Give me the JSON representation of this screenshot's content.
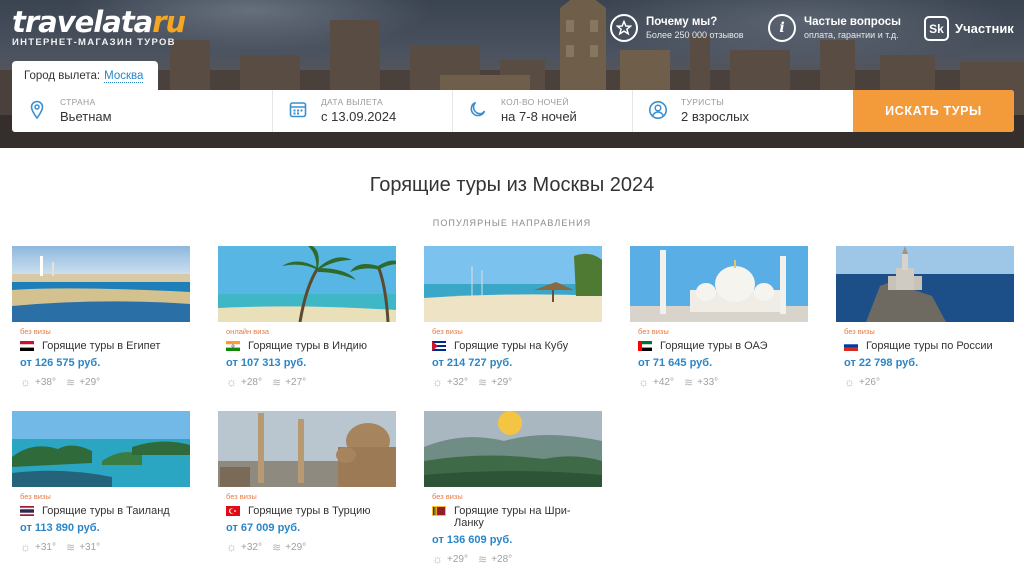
{
  "brand": {
    "logo_main": "travelata",
    "logo_ru": "ru",
    "logo_sub": "ИНТЕРНЕТ-МАГАЗИН ТУРОВ"
  },
  "top_links": [
    {
      "icon": "star-icon",
      "title": "Почему мы?",
      "sub": "Более 250 000 отзывов"
    },
    {
      "icon": "info-icon",
      "title": "Частые вопросы",
      "sub": "оплата, гарантии и т.д."
    }
  ],
  "member": {
    "badge": "Sk",
    "label": "Участник"
  },
  "departure": {
    "label": "Город вылета:",
    "value": "Москва"
  },
  "search": {
    "country": {
      "label": "Страна",
      "value": "Вьетнам",
      "icon": "location-pin-icon"
    },
    "date": {
      "label": "Дата вылета",
      "value": "с 13.09.2024",
      "icon": "calendar-icon"
    },
    "nights": {
      "label": "Кол-во ночей",
      "value": "на 7-8 ночей",
      "icon": "moon-icon"
    },
    "tourists": {
      "label": "Туристы",
      "value": "2 взрослых",
      "icon": "user-icon"
    },
    "button": "Искать туры"
  },
  "page_title": "Горящие туры из Москвы 2024",
  "section_sub": "ПОПУЛЯРНЫЕ НАПРАВЛЕНИЯ",
  "cards": [
    {
      "visa": "без визы",
      "title": "Горящие туры в Египет",
      "price": "от 126 575 руб.",
      "air": "+38°",
      "sea": "+29°",
      "flag": "egypt"
    },
    {
      "visa": "онлайн виза",
      "title": "Горящие туры в Индию",
      "price": "от 107 313 руб.",
      "air": "+28°",
      "sea": "+27°",
      "flag": "india"
    },
    {
      "visa": "без визы",
      "title": "Горящие туры на Кубу",
      "price": "от 214 727 руб.",
      "air": "+32°",
      "sea": "+29°",
      "flag": "cuba"
    },
    {
      "visa": "без визы",
      "title": "Горящие туры в ОАЭ",
      "price": "от 71 645 руб.",
      "air": "+42°",
      "sea": "+33°",
      "flag": "uae"
    },
    {
      "visa": "без визы",
      "title": "Горящие туры по России",
      "price": "от 22 798 руб.",
      "air": "+26°",
      "sea": "",
      "flag": "russia"
    },
    {
      "visa": "без визы",
      "title": "Горящие туры в Таиланд",
      "price": "от 113 890 руб.",
      "air": "+31°",
      "sea": "+31°",
      "flag": "thailand"
    },
    {
      "visa": "без визы",
      "title": "Горящие туры в Турцию",
      "price": "от 67 009 руб.",
      "air": "+32°",
      "sea": "+29°",
      "flag": "turkey"
    },
    {
      "visa": "без визы",
      "title": "Горящие туры на Шри-Ланку",
      "price": "от 136 609 руб.",
      "air": "+29°",
      "sea": "+28°",
      "flag": "srilanka"
    }
  ],
  "colors": {
    "accent_orange": "#f39a3b",
    "link_blue": "#2a86c8",
    "visa_orange": "#e47b46"
  }
}
